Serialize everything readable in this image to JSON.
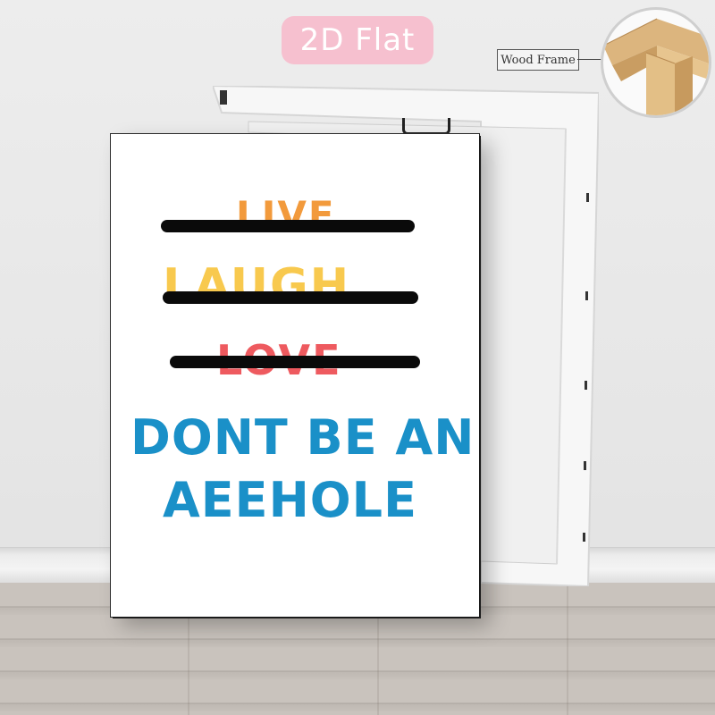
{
  "badge": {
    "label": "2D Flat"
  },
  "wood_frame": {
    "label": "Wood Frame"
  },
  "poster": {
    "crossed_out": [
      "LIVE",
      "LAUGH",
      "LOVE"
    ],
    "message_line1": "DONT BE AN",
    "message_line2": "AEEHOLE"
  },
  "colors": {
    "badge_bg": "#f6c0cf",
    "live": "#f29a3c",
    "laugh": "#f8c94e",
    "love": "#ee5a5f",
    "message": "#1a90c8",
    "strike": "#0a0a0a"
  }
}
